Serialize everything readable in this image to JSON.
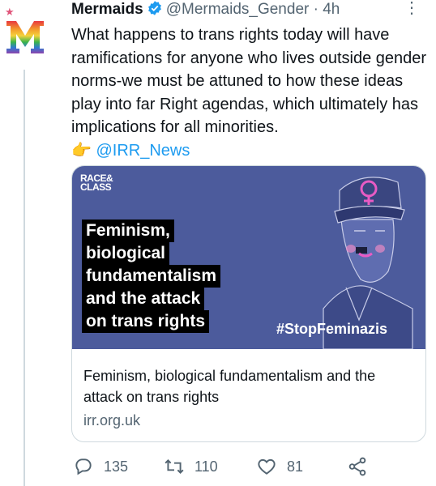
{
  "tweet": {
    "author_name": "Mermaids",
    "handle": "@Mermaids_Gender",
    "separator": "·",
    "time": "4h",
    "text": "What happens to trans rights today will have ramifications for anyone who lives outside gender norms-we must be attuned to how these ideas play into far Right agendas, which ultimately has implications for all minorities.",
    "pointing_emoji": "👉",
    "mention": "@IRR_News",
    "more_icon": "⋮"
  },
  "card": {
    "image_logo_line1": "RACE&",
    "image_logo_line2": "CLASS",
    "image_headline_lines": [
      "Feminism,",
      "biological",
      "fundamentalism",
      "and the attack",
      "on trans rights"
    ],
    "image_hashtag": "#StopFeminazis",
    "title": "Feminism, biological fundamentalism and the attack on trans rights",
    "domain": "irr.org.uk"
  },
  "actions": {
    "reply_count": "135",
    "retweet_count": "110",
    "like_count": "81"
  },
  "colors": {
    "accent": "#1d9bf0",
    "secondary_text": "#536471",
    "card_image_bg": "#4c5b9c"
  },
  "icons": [
    "verified-badge-icon",
    "more-icon",
    "reply-icon",
    "retweet-icon",
    "like-icon",
    "share-icon",
    "pointing-hand-emoji"
  ]
}
